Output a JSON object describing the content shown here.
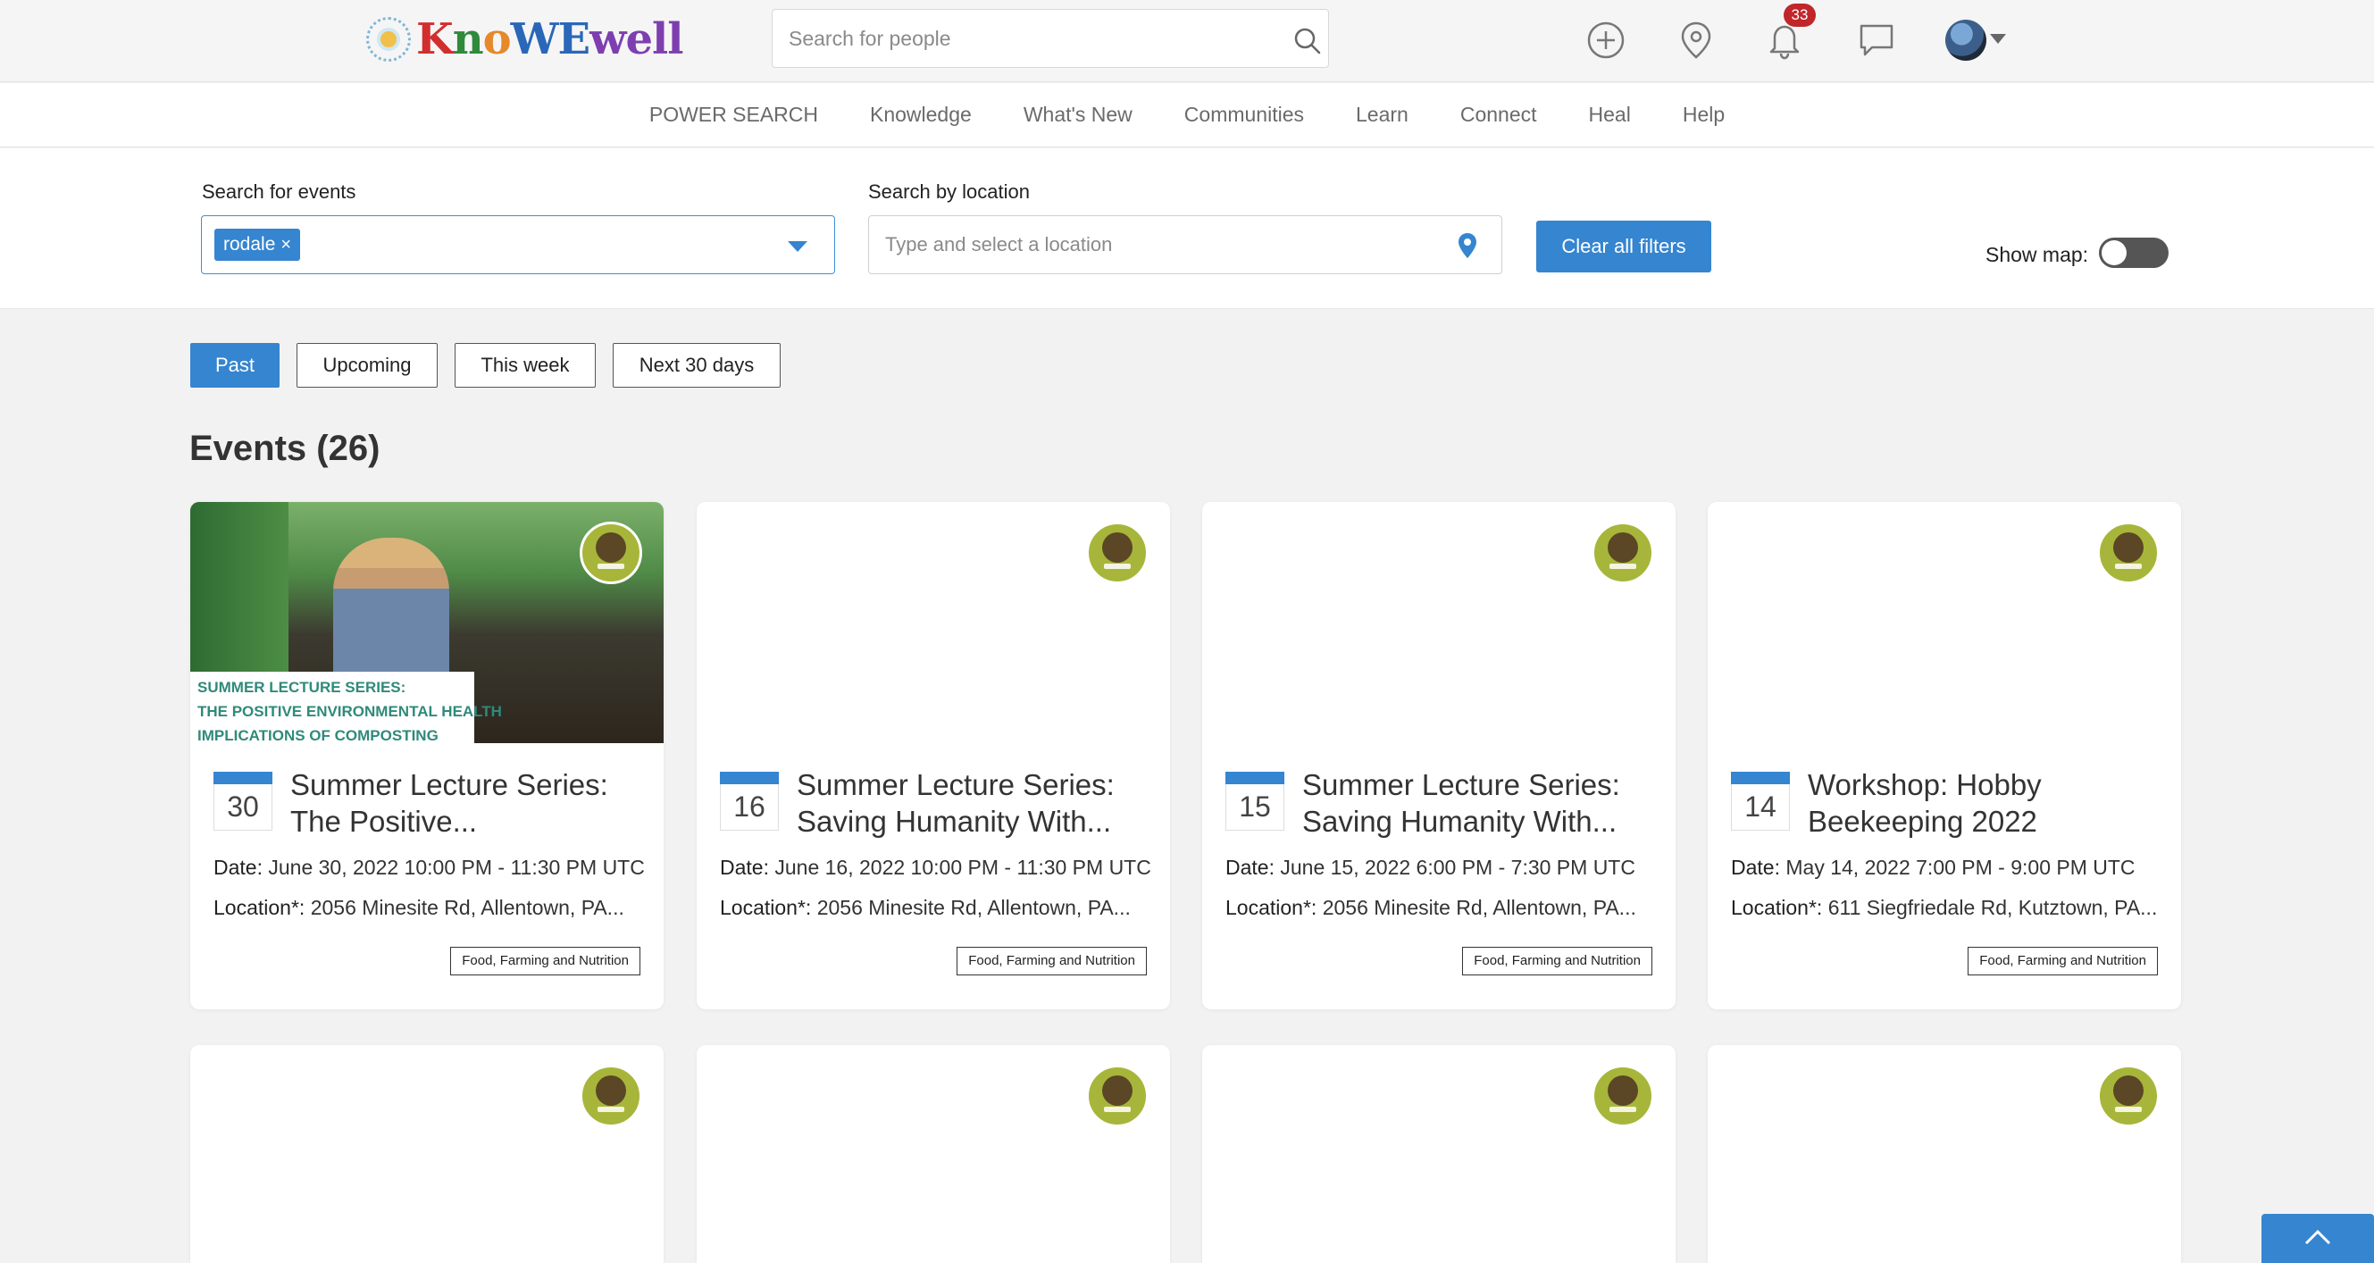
{
  "header": {
    "logo_text": [
      "K",
      "n",
      "o",
      "W",
      "E",
      "well"
    ],
    "people_search_placeholder": "Search for people",
    "notification_count": "33",
    "icons": [
      "add-icon",
      "location-icon",
      "bell-icon",
      "chat-icon",
      "avatar"
    ]
  },
  "nav": {
    "items": [
      "POWER SEARCH",
      "Knowledge",
      "What's New",
      "Communities",
      "Learn",
      "Connect",
      "Heal",
      "Help"
    ]
  },
  "filters": {
    "events_label": "Search for events",
    "events_chip": "rodale",
    "location_label": "Search by location",
    "location_placeholder": "Type and select a location",
    "clear_label": "Clear all filters",
    "map_label": "Show map:",
    "map_enabled": false
  },
  "time_filters": {
    "past": "Past",
    "upcoming": "Upcoming",
    "this_week": "This week",
    "next_30": "Next 30 days",
    "active": "Past"
  },
  "events_title": "Events (26)",
  "cards": [
    {
      "day": "30",
      "title_line1": "Summer Lecture Series:",
      "title_line2": "The Positive...",
      "date_label": "Date:",
      "date_value": "June 30, 2022 10:00 PM - 11:30 PM UTC",
      "location_label": "Location*:",
      "location_value": "2056 Minesite Rd, Allentown, PA...",
      "tag": "Food, Farming and Nutrition",
      "image_caption": [
        "Summer Lecture Series:",
        "The Positive Environmental Health",
        "Implications of Composting"
      ]
    },
    {
      "day": "16",
      "title_line1": "Summer Lecture Series:",
      "title_line2": "Saving Humanity With...",
      "date_label": "Date:",
      "date_value": "June 16, 2022 10:00 PM - 11:30 PM UTC",
      "location_label": "Location*:",
      "location_value": "2056 Minesite Rd, Allentown, PA...",
      "tag": "Food, Farming and Nutrition"
    },
    {
      "day": "15",
      "title_line1": "Summer Lecture Series:",
      "title_line2": "Saving Humanity With...",
      "date_label": "Date:",
      "date_value": "June 15, 2022 6:00 PM - 7:30 PM UTC",
      "location_label": "Location*:",
      "location_value": "2056 Minesite Rd, Allentown, PA...",
      "tag": "Food, Farming and Nutrition"
    },
    {
      "day": "14",
      "title_line1": "Workshop: Hobby",
      "title_line2": "Beekeeping 2022",
      "date_label": "Date:",
      "date_value": "May 14, 2022 7:00 PM - 9:00 PM UTC",
      "location_label": "Location*:",
      "location_value": "611 Siegfriedale Rd, Kutztown, PA...",
      "tag": "Food, Farming and Nutrition"
    }
  ],
  "colors": {
    "accent": "#3585d0",
    "badge_red": "#c0262a",
    "rodale_green": "#a7b63a"
  }
}
